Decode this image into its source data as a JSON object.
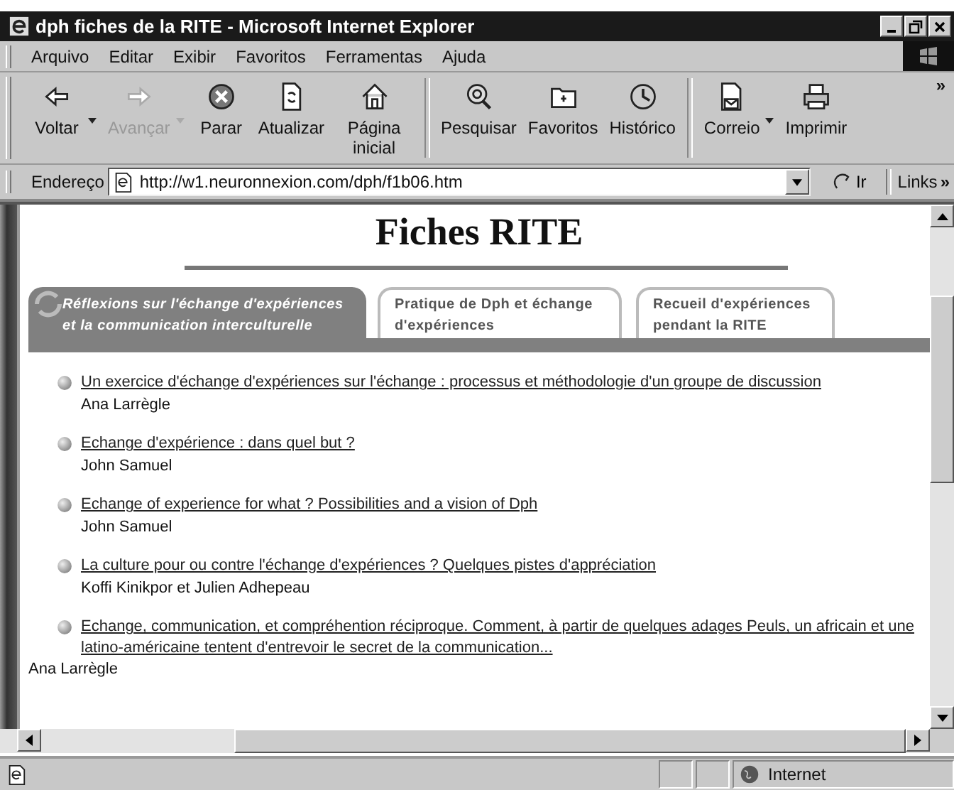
{
  "window": {
    "title": "dph fiches de la RITE - Microsoft Internet Explorer"
  },
  "menu": [
    "Arquivo",
    "Editar",
    "Exibir",
    "Favoritos",
    "Ferramentas",
    "Ajuda"
  ],
  "toolbar": [
    [
      {
        "kind": "back",
        "label": "Voltar",
        "disabled": false,
        "dropdown": true
      },
      {
        "kind": "forward",
        "label": "Avançar",
        "disabled": true,
        "dropdown": true
      },
      {
        "kind": "stop",
        "label": "Parar",
        "disabled": false,
        "dropdown": false
      },
      {
        "kind": "refresh",
        "label": "Atualizar",
        "disabled": false,
        "dropdown": false
      },
      {
        "kind": "home",
        "label": "Página inicial",
        "disabled": false,
        "dropdown": false
      }
    ],
    [
      {
        "kind": "search",
        "label": "Pesquisar",
        "disabled": false,
        "dropdown": false
      },
      {
        "kind": "favorites",
        "label": "Favoritos",
        "disabled": false,
        "dropdown": false
      },
      {
        "kind": "history",
        "label": "Histórico",
        "disabled": false,
        "dropdown": false
      }
    ],
    [
      {
        "kind": "mail",
        "label": "Correio",
        "disabled": false,
        "dropdown": true
      },
      {
        "kind": "print",
        "label": "Imprimir",
        "disabled": false,
        "dropdown": false
      }
    ]
  ],
  "toolbar_more": "»",
  "address": {
    "label": "Endereço",
    "value": "http://w1.neuronnexion.com/dph/f1b06.htm",
    "go": "Ir",
    "links": "Links",
    "links_more": "»"
  },
  "page": {
    "heading": "Fiches RITE",
    "tabs": [
      {
        "label": "Réflexions sur l'échange d'expériences et la communication interculturelle",
        "selected": true
      },
      {
        "label": "Pratique de Dph et échange d'expériences",
        "selected": false
      },
      {
        "label": "Recueil d'expériences pendant la RITE",
        "selected": false
      }
    ],
    "items": [
      {
        "title": "Un exercice d'échange d'expériences sur l'échange : processus et méthodologie d'un groupe de discussion",
        "author": "Ana Larrègle",
        "author_indented": true
      },
      {
        "title": "Echange d'expérience : dans quel but ?",
        "author": "John Samuel",
        "author_indented": true
      },
      {
        "title": "Echange of experience for what ? Possibilities and a vision of Dph",
        "author": "John Samuel",
        "author_indented": true
      },
      {
        "title": "La culture pour ou contre l'échange d'expériences ? Quelques pistes d'appréciation",
        "author": "Koffi Kinikpor et Julien Adhepeau",
        "author_indented": true
      },
      {
        "title": "Echange, communication, et compréhention réciproque. Comment, à partir de quelques adages Peuls, un africain et une latino-américaine tentent d'entrevoir le secret de la communication...",
        "author": "Ana Larrègle",
        "author_indented": false
      }
    ]
  },
  "status_bar": {
    "zone": "Internet"
  }
}
